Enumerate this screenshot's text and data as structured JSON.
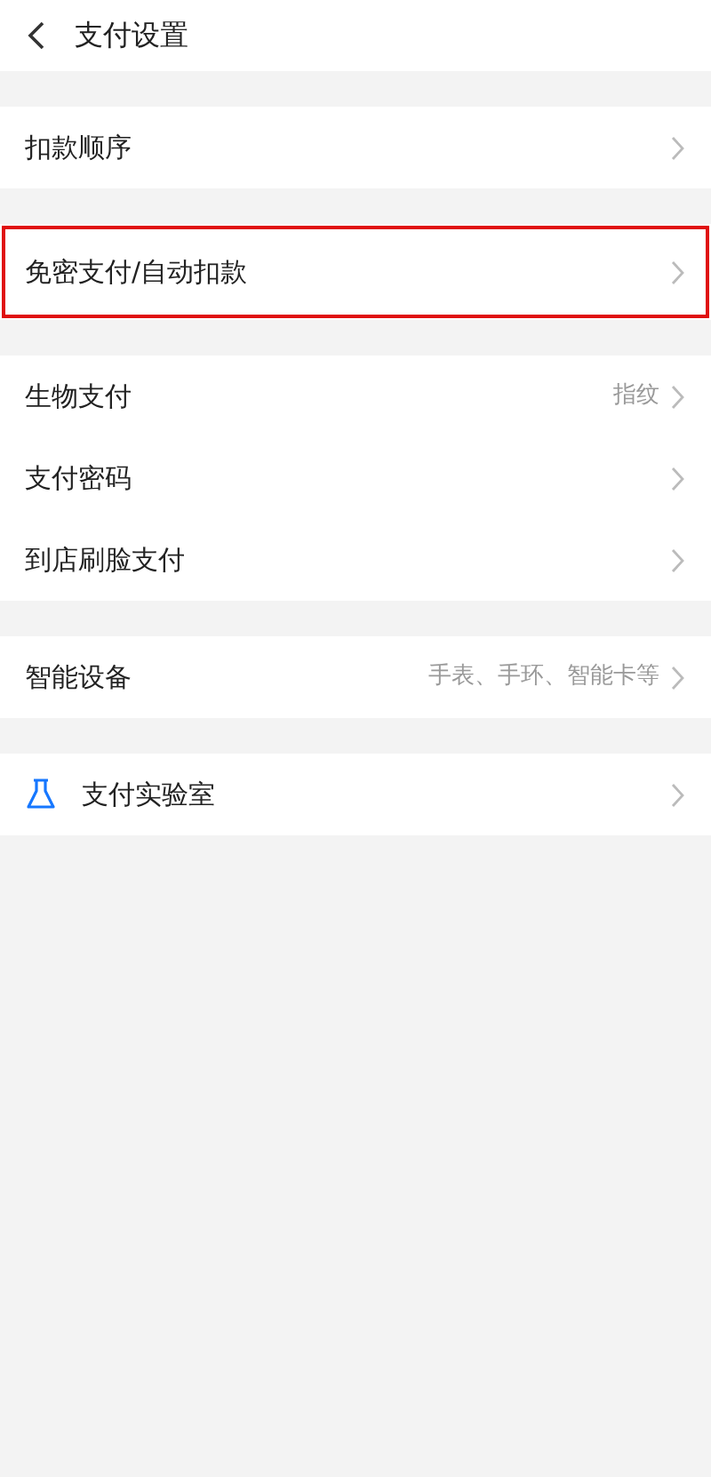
{
  "header": {
    "title": "支付设置"
  },
  "groups": [
    {
      "items": [
        {
          "kind": "plain",
          "label": "扣款顺序",
          "highlighted": false
        }
      ]
    },
    {
      "items": [
        {
          "kind": "plain",
          "label": "免密支付/自动扣款",
          "highlighted": true
        }
      ]
    },
    {
      "items": [
        {
          "kind": "plain",
          "label": "生物支付",
          "value": "指纹",
          "highlighted": false
        },
        {
          "kind": "plain",
          "label": "支付密码",
          "highlighted": false
        },
        {
          "kind": "plain",
          "label": "到店刷脸支付",
          "highlighted": false
        }
      ]
    },
    {
      "items": [
        {
          "kind": "plain",
          "label": "智能设备",
          "value": "手表、手环、智能卡等",
          "highlighted": false
        }
      ]
    },
    {
      "items": [
        {
          "kind": "with-icon",
          "label": "支付实验室",
          "highlighted": false
        }
      ]
    }
  ]
}
